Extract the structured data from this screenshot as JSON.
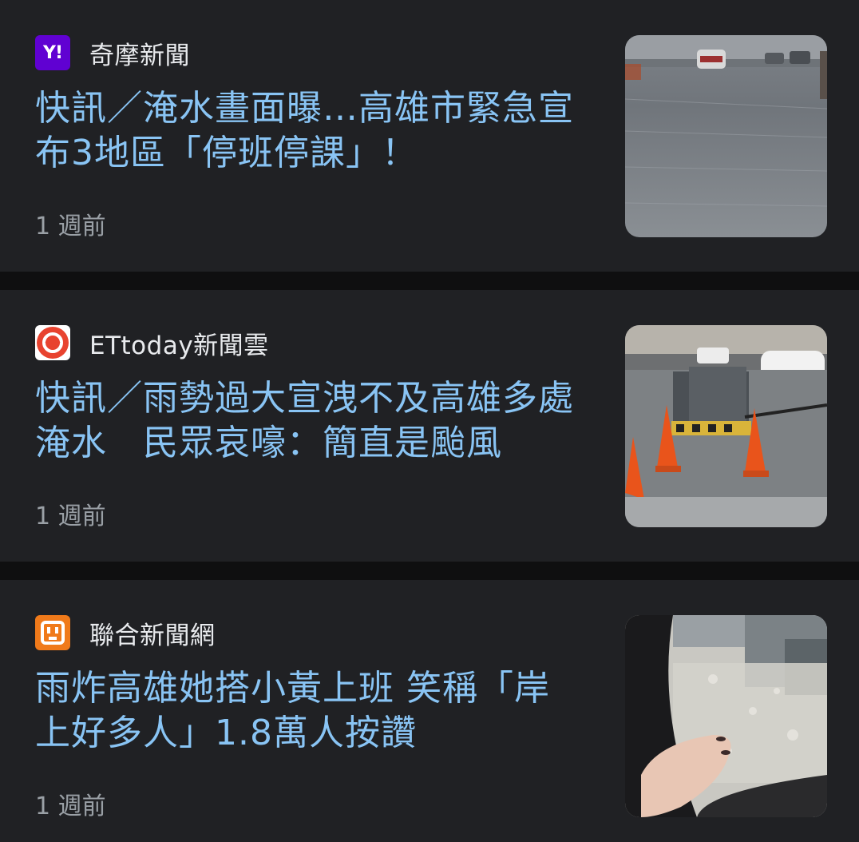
{
  "articles": [
    {
      "source": "奇摩新聞",
      "logo_icon": "yahoo-logo-icon",
      "logo_color": "#6001d2",
      "headline": "快訊／淹水畫面曝…高雄市緊急宣布3地區「停班停課」！",
      "time": "1 週前",
      "thumbnail": "flooded-road-thumbnail"
    },
    {
      "source": "ETtoday新聞雲",
      "logo_icon": "ettoday-logo-icon",
      "logo_color": "#e8432f",
      "headline": "快訊／雨勢過大宣洩不及高雄多處淹水　民眾哀嚎：簡直是颱風",
      "time": "1 週前",
      "thumbnail": "traffic-cones-flood-thumbnail"
    },
    {
      "source": "聯合新聞網",
      "logo_icon": "udn-logo-icon",
      "logo_color": "#f07a1a",
      "headline": "雨炸高雄她搭小黃上班 笑稱「岸上好多人」1.8萬人按讚",
      "time": "1 週前",
      "thumbnail": "taxi-window-rain-thumbnail"
    }
  ],
  "logo_text": {
    "yahoo": "Y!"
  }
}
